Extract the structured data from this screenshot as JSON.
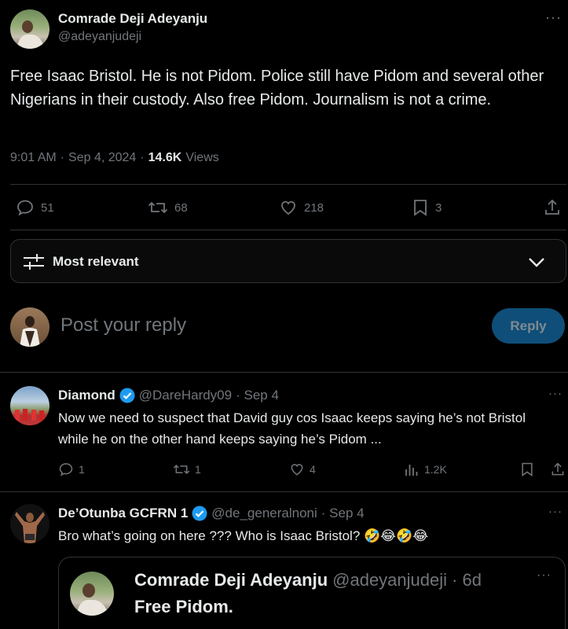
{
  "tweet": {
    "author_name": "Comrade Deji Adeyanju",
    "author_handle": "@adeyanjudeji",
    "text": "Free Isaac Bristol. He is not Pidom. Police still have Pidom and several other Nigerians in their custody. Also free Pidom. Journalism is not a crime.",
    "time": "9:01 AM",
    "sep": "·",
    "date": "Sep 4, 2024",
    "views_count": "14.6K",
    "views_label": "Views",
    "replies": "51",
    "reposts": "68",
    "likes": "218",
    "bookmarks": "3"
  },
  "sort": {
    "label": "Most relevant"
  },
  "composer": {
    "placeholder": "Post your reply",
    "reply_button": "Reply"
  },
  "replies": [
    {
      "name": "Diamond",
      "verified": true,
      "handle": "@DareHardy09",
      "date": "· Sep 4",
      "text": "Now we need to suspect that David guy cos Isaac keeps saying he’s not Bristol while he on the other hand keeps saying he’s Pidom ...",
      "replies": "1",
      "reposts": "1",
      "likes": "4",
      "views": "1.2K"
    },
    {
      "name": "De’Otunba GCFRN 1",
      "verified": true,
      "handle": "@de_generalnoni",
      "date": "· Sep 4",
      "text": "Bro what’s going on here ??? Who is Isaac Bristol? 🤣😂🤣😂",
      "quote": {
        "name": "Comrade Deji Adeyanju",
        "handle": "@adeyanjudeji",
        "date": "· 6d",
        "text": "Free Pidom."
      }
    }
  ],
  "colors": {
    "accent": "#1d9bf0",
    "reply_btn_bg": "#0f4e78",
    "border": "#2f3336",
    "muted": "#71767b",
    "text": "#e7e9ea"
  }
}
